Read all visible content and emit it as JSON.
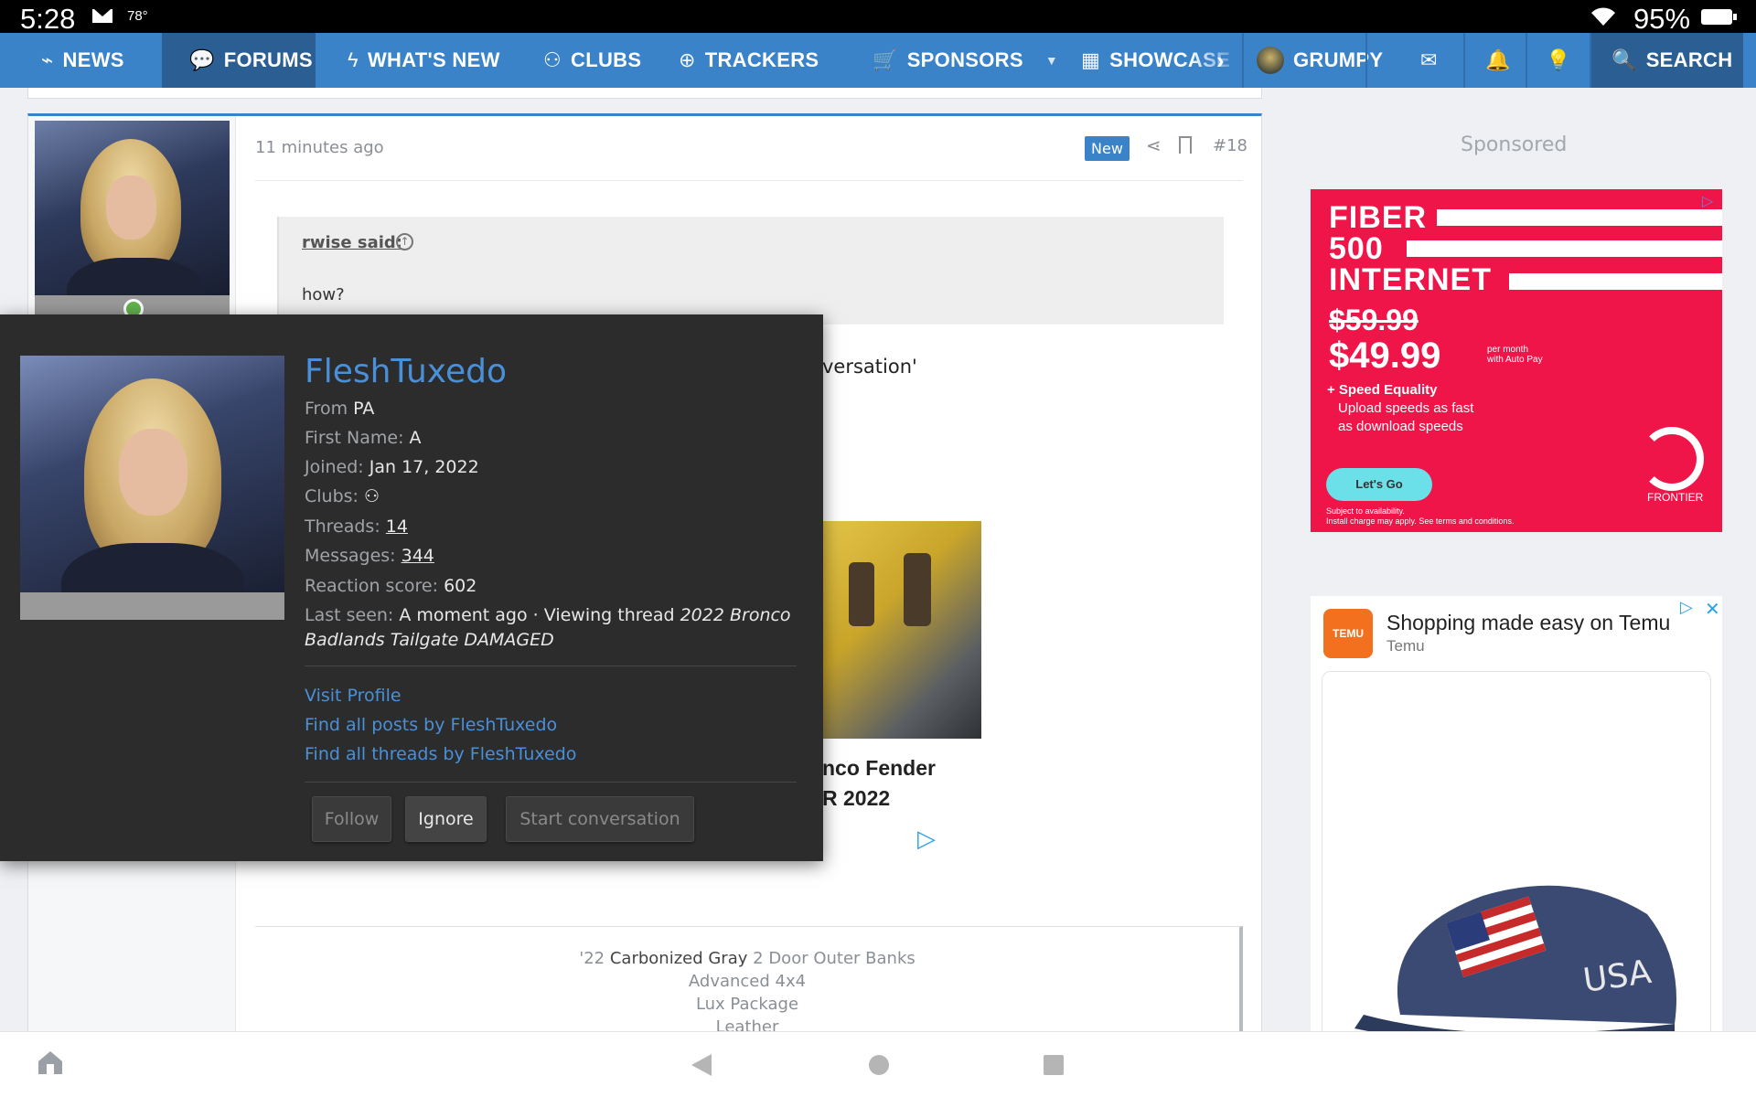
{
  "status_bar": {
    "time": "5:28",
    "temperature": "78°",
    "battery": "95%"
  },
  "nav": {
    "items": [
      {
        "label": "NEWS",
        "icon": "news-icon"
      },
      {
        "label": "FORUMS",
        "icon": "forums-icon",
        "active": true
      },
      {
        "label": "WHAT'S NEW",
        "icon": "bolt-icon"
      },
      {
        "label": "CLUBS",
        "icon": "clubs-icon"
      },
      {
        "label": "TRACKERS",
        "icon": "globe-icon"
      },
      {
        "label": "SPONSORS",
        "icon": "cart-icon"
      },
      {
        "label": "SHOWCASE",
        "icon": "table-icon"
      }
    ],
    "user": "GRUMPY",
    "search_label": "SEARCH",
    "accent_color": "#3b83c9"
  },
  "post": {
    "time": "11 minutes ago",
    "badge": "New",
    "number": "#18",
    "quote_author": "rwise said:",
    "quote_text": "how?",
    "visible_text": "versation'",
    "thumb_title_line1": "nco Fender",
    "thumb_title_line2": "R 2022"
  },
  "signature": {
    "year": "'22",
    "color": "Carbonized Gray",
    "model": "2 Door Outer Banks",
    "line2": "Advanced 4x4",
    "line3": "Lux Package",
    "line4": "Leather"
  },
  "popup": {
    "username": "FleshTuxedo",
    "from_label": "From",
    "from_value": "PA",
    "first_name_label": "First Name:",
    "first_name_value": "A",
    "joined_label": "Joined:",
    "joined_value": "Jan 17, 2022",
    "clubs_label": "Clubs:",
    "threads_label": "Threads:",
    "threads_value": "14",
    "messages_label": "Messages:",
    "messages_value": "344",
    "reaction_label": "Reaction score:",
    "reaction_value": "602",
    "last_seen_label": "Last seen:",
    "last_seen_value": "A moment ago · Viewing thread",
    "last_seen_thread": "2022 Bronco Badlands Tailgate DAMAGED",
    "links": [
      "Visit Profile",
      "Find all posts by FleshTuxedo",
      "Find all threads by FleshTuxedo"
    ],
    "buttons": {
      "follow": "Follow",
      "ignore": "Ignore",
      "start": "Start conversation"
    }
  },
  "sidebar": {
    "sponsored_label": "Sponsored",
    "ad1": {
      "line1": "FIBER",
      "line2": "500",
      "line3": "INTERNET",
      "old_price": "$59.99",
      "price": "$49.99",
      "per_month": "per month",
      "auto_pay": "with Auto Pay",
      "feature": "+ Speed Equality",
      "feature_desc1": "Upload speeds as fast",
      "feature_desc2": "as download speeds",
      "cta": "Let's Go",
      "brand": "FRONTIER",
      "fine1": "Subject to availability.",
      "fine2": "Install charge may apply. See terms and conditions.",
      "color": "#ef1549"
    },
    "ad2": {
      "title": "Shopping made easy on Temu",
      "subtitle": "Temu",
      "logo_text": "TEMU"
    }
  }
}
